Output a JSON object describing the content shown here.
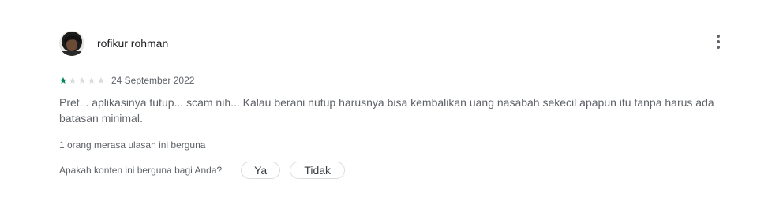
{
  "review": {
    "author": "rofikur rohman",
    "rating": 1,
    "max_rating": 5,
    "date": "24 September 2022",
    "text": "Pret... aplikasinya tutup... scam nih... Kalau berani nutup harusnya bisa kembalikan uang nasabah sekecil apapun itu tanpa harus ada batasan minimal.",
    "helpful_count_text": "1 orang merasa ulasan ini berguna",
    "feedback_question": "Apakah konten ini berguna bagi Anda?",
    "yes_label": "Ya",
    "no_label": "Tidak"
  },
  "icons": {
    "more": "more-vert-icon",
    "star": "star-icon"
  },
  "colors": {
    "star_filled": "#01875f",
    "star_empty": "#dadce0",
    "secondary_text": "#5f6368"
  }
}
